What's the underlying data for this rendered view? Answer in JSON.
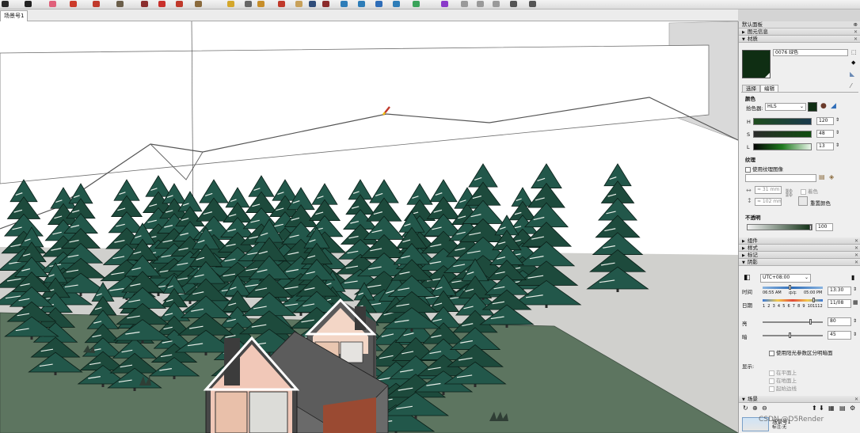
{
  "document": {
    "scene_tab": "场景号1"
  },
  "toolbar": {
    "tools": [
      {
        "name": "zoom-tool",
        "icon": "magnifier-icon",
        "color": "#2a2a2a"
      },
      {
        "name": "select-tool",
        "icon": "arrow-cursor-icon",
        "color": "#222222"
      },
      {
        "name": "eraser-tool",
        "icon": "eraser-icon",
        "color": "#e0607a"
      },
      {
        "name": "line-tool",
        "icon": "pencil-icon",
        "color": "#cc3a2a"
      },
      {
        "name": "arc-tool",
        "icon": "arc-icon",
        "color": "#c0392b"
      },
      {
        "name": "shape-tool",
        "icon": "rectangle-icon",
        "color": "#6b5f4b"
      },
      {
        "name": "push-pull-tool",
        "icon": "push-pull-icon",
        "color": "#8b2e2e"
      },
      {
        "name": "follow-me-tool",
        "icon": "follow-me-icon",
        "color": "#c9302c"
      },
      {
        "name": "move-tool",
        "icon": "move-cross-icon",
        "color": "#c0392b"
      },
      {
        "name": "paint-tool",
        "icon": "paint-bucket-icon",
        "color": "#8a6a3d"
      },
      {
        "name": "tape-measure-tool",
        "icon": "tape-measure-icon",
        "color": "#d4a72c"
      },
      {
        "name": "text-tool",
        "icon": "text-icon",
        "color": "#666666"
      },
      {
        "name": "section-plane-tool",
        "icon": "section-plane-icon",
        "color": "#c78e2a"
      },
      {
        "name": "orbit-tool",
        "icon": "orbit-icon",
        "color": "#c0392b"
      },
      {
        "name": "pan-tool",
        "icon": "pan-hand-icon",
        "color": "#c8a15a"
      },
      {
        "name": "zoom-window-tool",
        "icon": "zoom-window-icon",
        "color": "#2f4d7a"
      },
      {
        "name": "zoom-extents-tool",
        "icon": "zoom-extents-icon",
        "color": "#8b2b2b"
      },
      {
        "name": "warehouse-tool",
        "icon": "warehouse-icon",
        "color": "#2e7db8"
      },
      {
        "name": "extension-warehouse-tool",
        "icon": "extension-warehouse-icon",
        "color": "#2e7db8"
      },
      {
        "name": "layers-tool",
        "icon": "layers-icon",
        "color": "#2e6db8"
      },
      {
        "name": "send-to-layout-tool",
        "icon": "layout-icon",
        "color": "#2e7db8"
      },
      {
        "name": "extension-manager-tool",
        "icon": "extension-manager-icon",
        "color": "#3aa35a"
      },
      {
        "name": "ruby-console-tool",
        "icon": "ruby-icon",
        "color": "#8a3ac9"
      },
      {
        "name": "solid-union-tool",
        "icon": "solid-tools-icon",
        "color": "#9a9a9a"
      },
      {
        "name": "solid-subtract-tool",
        "icon": "solid-tools-icon",
        "color": "#9a9a9a"
      },
      {
        "name": "solid-trim-tool",
        "icon": "solid-tools-icon",
        "color": "#9a9a9a"
      },
      {
        "name": "geo-location-tool",
        "icon": "location-icon",
        "color": "#555555"
      },
      {
        "name": "settings-tool",
        "icon": "gear-icon",
        "color": "#555555"
      }
    ]
  },
  "tray": {
    "title": "默认面板",
    "sections": {
      "entity_info": "图元信息",
      "materials": "材质",
      "components": "组件",
      "styles": "样式",
      "tags": "标记",
      "shadows": "阴影",
      "scenes": "场景"
    },
    "materials": {
      "material_name": "0076 绿色",
      "swatch_color": "#0f2e13",
      "tabs": [
        "选择",
        "编辑"
      ],
      "active_tab": "编辑",
      "color_heading": "颜色",
      "picker_label": "拾色器:",
      "picker_value": "HLS",
      "rows": [
        {
          "label": "H",
          "value": "120",
          "gradient": "linear-gradient(90deg,#1e4d1e,#1a3a4d)"
        },
        {
          "label": "S",
          "value": "48",
          "gradient": "linear-gradient(90deg,#2b2b2b,#0f4d0f)"
        },
        {
          "label": "L",
          "value": "13",
          "gradient": "linear-gradient(90deg,#050505,#1f7a1f,#e9f5e9)"
        }
      ],
      "texture_heading": "纹理",
      "use_texture": "使用纹理图像",
      "width_value": "≈ 31 mm",
      "height_value": "≈ 102 mm",
      "colorize": "着色",
      "reset_color": "重置颜色",
      "opacity_heading": "不透明",
      "opacity_value": "100",
      "opacity_fraction": 1.0
    },
    "shadows": {
      "timezone": "UTC+08:00",
      "time_label": "时间",
      "time_ticks": [
        "06:55 AM",
        "中午",
        "05:00 PM"
      ],
      "time_value": "13:30",
      "date_label": "日期",
      "months": [
        "1",
        "2",
        "3",
        "4",
        "5",
        "6",
        "7",
        "8",
        "9",
        "10",
        "11",
        "12"
      ],
      "date_value": "11/08",
      "light_label": "亮",
      "light_value": "80",
      "light_fraction": 0.8,
      "dark_label": "暗",
      "dark_value": "45",
      "dark_fraction": 0.45,
      "use_sun_shading": "使用阳光参数区分明暗面",
      "display_label": "显示:",
      "on_faces": "在平面上",
      "on_ground": "在地面上",
      "from_edges": "起始边线"
    },
    "scenes": {
      "scene_name": "场景号1",
      "label_prefix": "标注:",
      "label_value": "无"
    }
  },
  "watermark": "CSDN @D5Render"
}
